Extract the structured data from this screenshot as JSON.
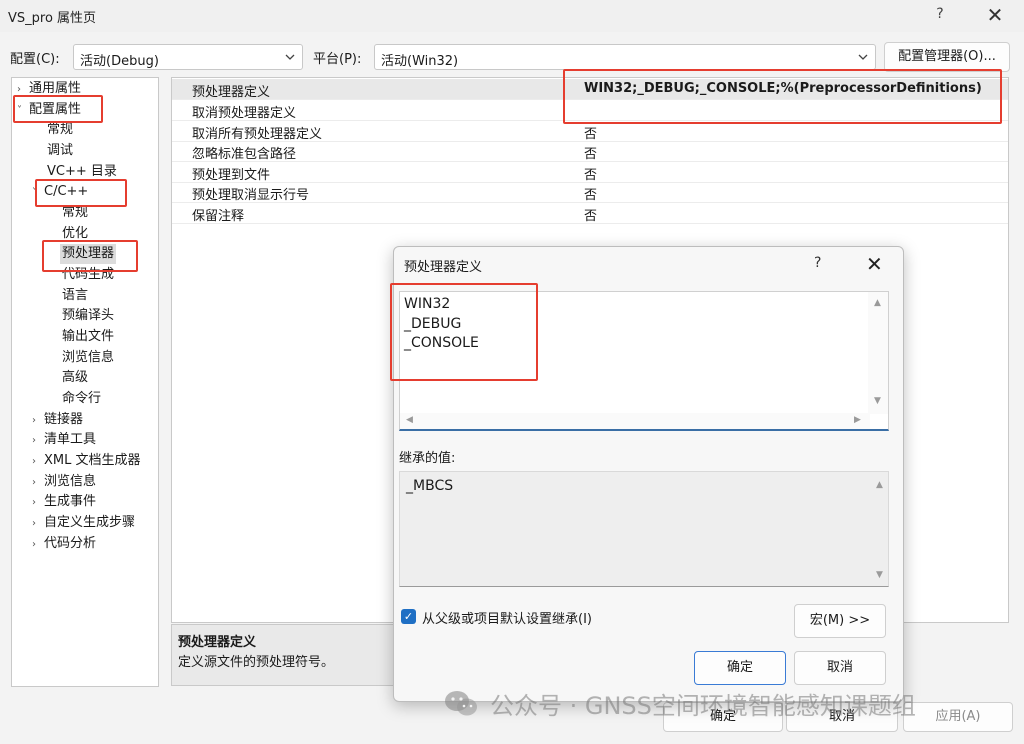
{
  "window": {
    "title": "VS_pro 属性页",
    "help": "?",
    "close": "✕"
  },
  "config": {
    "config_label": "配置(C):",
    "config_value": "活动(Debug)",
    "platform_label": "平台(P):",
    "platform_value": "活动(Win32)",
    "manager_button": "配置管理器(O)..."
  },
  "tree": {
    "items": [
      {
        "label": "通用属性",
        "toggle": "›"
      },
      {
        "label": "配置属性",
        "toggle": "˅"
      },
      {
        "label": "常规"
      },
      {
        "label": "调试"
      },
      {
        "label": "VC++ 目录"
      },
      {
        "label": "C/C++",
        "toggle": "˅"
      },
      {
        "label": "常规"
      },
      {
        "label": "优化"
      },
      {
        "label": "预处理器"
      },
      {
        "label": "代码生成"
      },
      {
        "label": "语言"
      },
      {
        "label": "预编译头"
      },
      {
        "label": "输出文件"
      },
      {
        "label": "浏览信息"
      },
      {
        "label": "高级"
      },
      {
        "label": "命令行"
      },
      {
        "label": "链接器",
        "toggle": "›"
      },
      {
        "label": "清单工具",
        "toggle": "›"
      },
      {
        "label": "XML 文档生成器",
        "toggle": "›"
      },
      {
        "label": "浏览信息",
        "toggle": "›"
      },
      {
        "label": "生成事件",
        "toggle": "›"
      },
      {
        "label": "自定义生成步骤",
        "toggle": "›"
      },
      {
        "label": "代码分析",
        "toggle": "›"
      }
    ]
  },
  "grid": {
    "rows": [
      {
        "key": "预处理器定义",
        "value": "WIN32;_DEBUG;_CONSOLE;%(PreprocessorDefinitions)"
      },
      {
        "key": "取消预处理器定义",
        "value": ""
      },
      {
        "key": "取消所有预处理器定义",
        "value": "否"
      },
      {
        "key": "忽略标准包含路径",
        "value": "否"
      },
      {
        "key": "预处理到文件",
        "value": "否"
      },
      {
        "key": "预处理取消显示行号",
        "value": "否"
      },
      {
        "key": "保留注释",
        "value": "否"
      }
    ]
  },
  "description": {
    "title": "预处理器定义",
    "text": "定义源文件的预处理符号。"
  },
  "outer_buttons": {
    "ok": "确定",
    "cancel": "取消",
    "apply": "应用(A)"
  },
  "dialog": {
    "title": "预处理器定义",
    "help": "?",
    "close": "✕",
    "lines": [
      "WIN32",
      "_DEBUG",
      "_CONSOLE"
    ],
    "inherited_label": "继承的值:",
    "inherited_lines": [
      "_MBCS"
    ],
    "inherit_checkbox_label": "从父级或项目默认设置继承(I)",
    "inherit_checked": true,
    "macros_button": "宏(M) >>",
    "ok": "确定",
    "cancel": "取消"
  },
  "watermark": {
    "text": "公众号 · GNSS空间环境智能感知课题组",
    "icon": "wechat-icon"
  },
  "colors": {
    "highlight_box": "#e53d2f",
    "checkbox": "#1f6fc4"
  }
}
